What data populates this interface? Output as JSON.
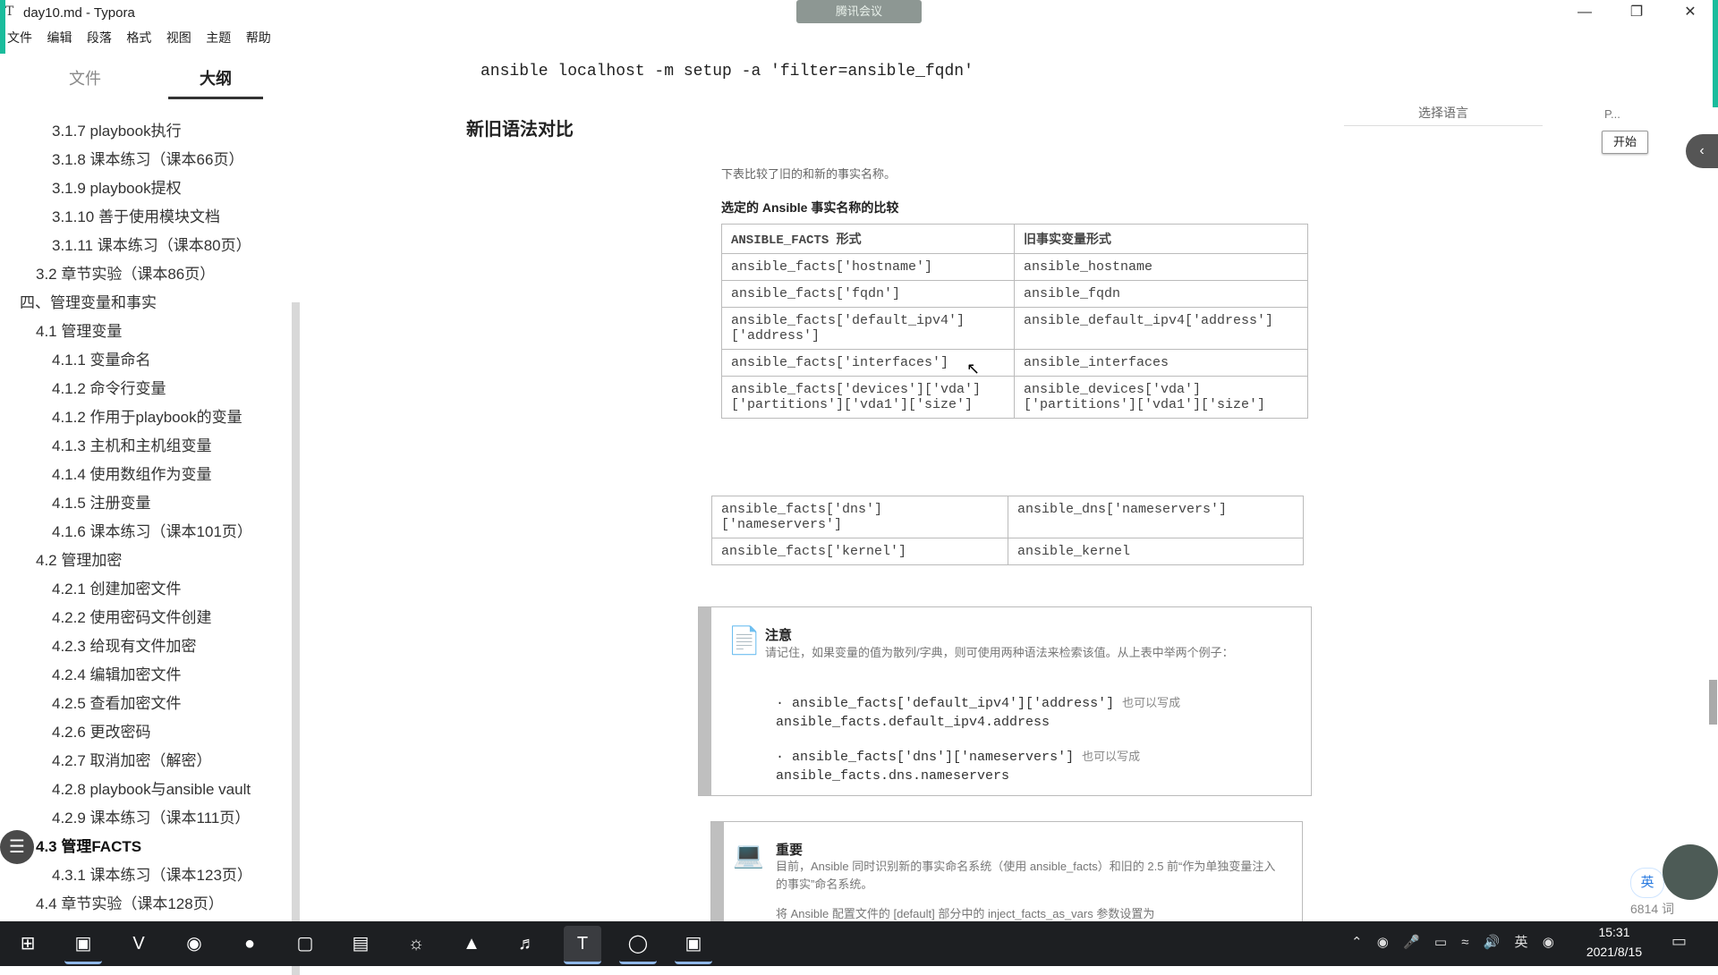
{
  "window": {
    "app_icon": "T",
    "title": "day10.md - Typora",
    "meeting_badge": "腾讯会议"
  },
  "menu": [
    "文件",
    "编辑",
    "段落",
    "格式",
    "视图",
    "主题",
    "帮助"
  ],
  "sidebar": {
    "tabs": {
      "files": "文件",
      "outline": "大纲"
    },
    "outline": [
      {
        "label": "3.1.7 playbook执行",
        "level": 3
      },
      {
        "label": "3.1.8 课本练习（课本66页）",
        "level": 3
      },
      {
        "label": "3.1.9 playbook提权",
        "level": 3
      },
      {
        "label": "3.1.10 善于使用模块文档",
        "level": 3
      },
      {
        "label": "3.1.11 课本练习（课本80页）",
        "level": 3
      },
      {
        "label": "3.2 章节实验（课本86页）",
        "level": 2
      },
      {
        "label": "四、管理变量和事实",
        "level": 1
      },
      {
        "label": "4.1 管理变量",
        "level": 2
      },
      {
        "label": "4.1.1 变量命名",
        "level": 3
      },
      {
        "label": "4.1.2 命令行变量",
        "level": 3
      },
      {
        "label": "4.1.2 作用于playbook的变量",
        "level": 3
      },
      {
        "label": "4.1.3 主机和主机组变量",
        "level": 3
      },
      {
        "label": "4.1.4 使用数组作为变量",
        "level": 3
      },
      {
        "label": "4.1.5 注册变量",
        "level": 3
      },
      {
        "label": "4.1.6 课本练习（课本101页）",
        "level": 3
      },
      {
        "label": "4.2 管理加密",
        "level": 2
      },
      {
        "label": "4.2.1 创建加密文件",
        "level": 3
      },
      {
        "label": "4.2.2 使用密码文件创建",
        "level": 3
      },
      {
        "label": "4.2.3 给现有文件加密",
        "level": 3
      },
      {
        "label": "4.2.4 编辑加密文件",
        "level": 3
      },
      {
        "label": "4.2.5 查看加密文件",
        "level": 3
      },
      {
        "label": "4.2.6 更改密码",
        "level": 3
      },
      {
        "label": "4.2.7 取消加密（解密）",
        "level": 3
      },
      {
        "label": "4.2.8 playbook与ansible vault",
        "level": 3
      },
      {
        "label": "4.2.9 课本练习（课本111页）",
        "level": 3
      },
      {
        "label": "4.3 管理FACTS",
        "level": 2,
        "active": true
      },
      {
        "label": "4.3.1 课本练习（课本123页）",
        "level": 3
      },
      {
        "label": "4.4 章节实验（课本128页）",
        "level": 2
      }
    ]
  },
  "editor": {
    "command": "ansible localhost -m setup -a 'filter=ansible_fqdn'",
    "heading": "新旧语法对比",
    "lang_label": "选择语言",
    "p_label": "P...",
    "start_button": "开始"
  },
  "scan": {
    "intro": "下表比较了旧的和新的事实名称。",
    "caption": "选定的 Ansible 事实名称的比较",
    "headers": [
      "ANSIBLE_FACTS 形式",
      "旧事实变量形式"
    ],
    "rows": [
      [
        "ansible_facts['hostname']",
        "ansible_hostname"
      ],
      [
        "ansible_facts['fqdn']",
        "ansible_fqdn"
      ],
      [
        "ansible_facts['default_ipv4']\n['address']",
        "ansible_default_ipv4['address']"
      ],
      [
        "ansible_facts['interfaces']",
        "ansible_interfaces"
      ],
      [
        "ansible_facts['devices']['vda']\n['partitions']['vda1']['size']",
        "ansible_devices['vda']\n['partitions']['vda1']['size']"
      ]
    ],
    "rows2": [
      [
        "ansible_facts['dns']\n['nameservers']",
        "ansible_dns['nameservers']"
      ],
      [
        "ansible_facts['kernel']",
        "ansible_kernel"
      ]
    ],
    "note": {
      "title": "注意",
      "text": "请记住，如果变量的值为散列/字典，则可使用两种语法来检索该值。从上表中举两个例子：",
      "code1_a": "ansible_facts['default_ipv4']['address']",
      "code1_after": "也可以写成",
      "code1_b": "ansible_facts.default_ipv4.address",
      "code2_a": "ansible_facts['dns']['nameservers']",
      "code2_after": "也可以写成",
      "code2_b": "ansible_facts.dns.nameservers"
    },
    "important": {
      "title": "重要",
      "text": "目前，Ansible 同时识别新的事实命名系统（使用 ansible_facts）和旧的 2.5 前“作为单独变量注入的事实”命名系统。",
      "text2": "将 Ansible 配置文件的 [default] 部分中的 inject_facts_as_vars 参数设置为"
    }
  },
  "status": {
    "ime": "英",
    "word_count": "6814 词"
  },
  "taskbar": {
    "apps": [
      "start-icon",
      "image-viewer-icon",
      "vivaldi-icon",
      "chrome-icon",
      "wechat-icon",
      "window-manager-icon",
      "file-explorer-icon",
      "steam-icon",
      "vmware-icon",
      "netease-music-icon",
      "typora-icon",
      "tencent-meeting-icon",
      "screenshot-icon"
    ],
    "tray_lang": "英",
    "time": "15:31",
    "date": "2021/8/15"
  }
}
